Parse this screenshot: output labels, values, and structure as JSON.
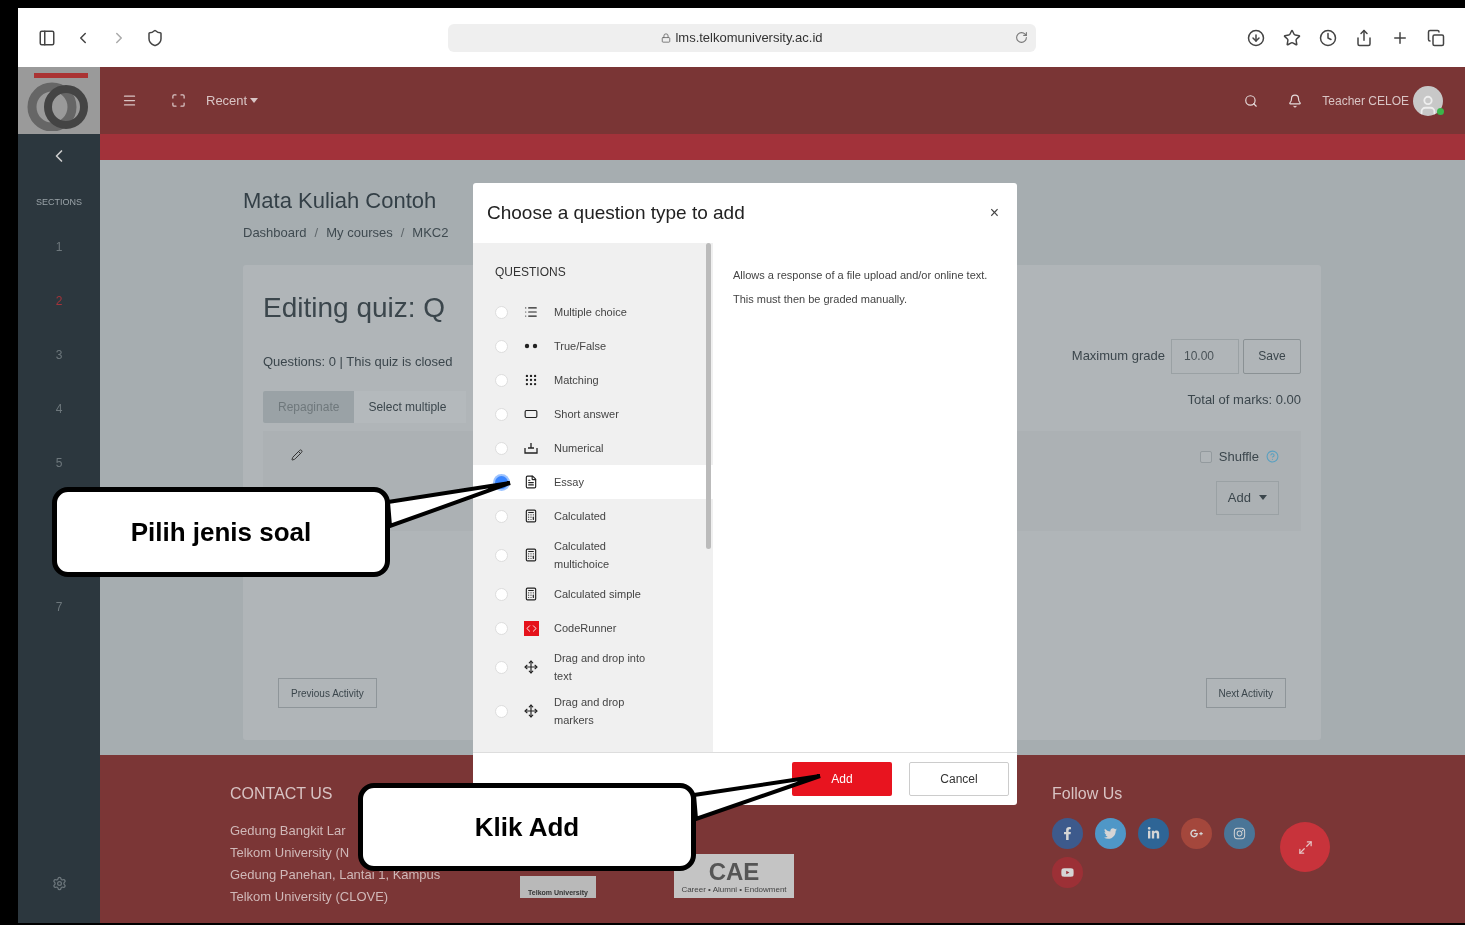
{
  "browser": {
    "url": "lms.telkomuniversity.ac.id"
  },
  "header": {
    "menu_label": "Recent",
    "user_name": "Teacher CELOE",
    "online": true
  },
  "sidebar": {
    "heading": "SECTIONS",
    "sections": [
      {
        "label": "1",
        "selected": false
      },
      {
        "label": "2",
        "selected": true
      },
      {
        "label": "3",
        "selected": false
      },
      {
        "label": "4",
        "selected": false
      },
      {
        "label": "5",
        "selected": false
      },
      {
        "label": "7",
        "selected": false
      }
    ]
  },
  "page": {
    "title": "Mata Kuliah Contoh",
    "breadcrumb": [
      "Dashboard",
      "My courses",
      "MKC2"
    ],
    "breadcrumb_separator": "/",
    "quiz_title": "Editing quiz: Q",
    "summary": "Questions: 0 | This quiz is closed",
    "repaginate": "Repaginate",
    "select_multiple": "Select multiple",
    "max_grade_label": "Maximum grade",
    "max_grade_value": "10.00",
    "save": "Save",
    "total_marks": "Total of marks: 0.00",
    "shuffle": {
      "label": "Shuffle",
      "checked": false
    },
    "add_menu": "Add",
    "previous": "Previous Activity",
    "next": "Next Activity"
  },
  "modal": {
    "title": "Choose a question type to add",
    "close": "×",
    "section": "QUESTIONS",
    "questions": [
      {
        "label": "Multiple choice",
        "kind": "list",
        "selected": false
      },
      {
        "label": "True/False",
        "kind": "dots",
        "selected": false
      },
      {
        "label": "Matching",
        "kind": "grid",
        "selected": false
      },
      {
        "label": "Short answer",
        "kind": "field",
        "selected": false
      },
      {
        "label": "Numerical",
        "kind": "numeric",
        "selected": false
      },
      {
        "label": "Essay",
        "kind": "page",
        "selected": true
      },
      {
        "label": "Calculated",
        "kind": "calc",
        "selected": false
      },
      {
        "label": "Calculated multichoice",
        "kind": "calc",
        "selected": false
      },
      {
        "label": "Calculated simple",
        "kind": "calc",
        "selected": false
      },
      {
        "label": "CodeRunner",
        "kind": "code",
        "selected": false
      },
      {
        "label": "Drag and drop into text",
        "kind": "move",
        "selected": false
      },
      {
        "label": "Drag and drop markers",
        "kind": "move",
        "selected": false
      }
    ],
    "description": "Allows a response of a file upload and/or online text. This must then be graded manually.",
    "buttons": [
      {
        "label": "Add",
        "kind": "primary"
      },
      {
        "label": "Cancel",
        "kind": "secondary"
      }
    ]
  },
  "footer": {
    "contact_heading": "CONTACT US",
    "contact_lines": [
      "Gedung Bangkit Lar",
      "Telkom University (N",
      "Gedung Panehan, Lantai 1, Kampus",
      "Telkom University (CLOVE)"
    ],
    "library_logo": "Telkom University",
    "cae_logo": "CAE",
    "cae_tagline": "Career • Alumni • Endowment",
    "follow_heading": "Follow Us",
    "social": [
      {
        "kind": "facebook",
        "color": "#3d5a8c"
      },
      {
        "kind": "twitter",
        "color": "#4f97c7"
      },
      {
        "kind": "linkedin",
        "color": "#2e6596"
      },
      {
        "kind": "googleplus",
        "color": "#a4473c"
      },
      {
        "kind": "instagram",
        "color": "#4a7597"
      },
      {
        "kind": "youtube",
        "color": "#9c3036"
      }
    ]
  },
  "callouts": [
    {
      "text": "Pilih jenis soal"
    },
    {
      "text": "Klik Add"
    }
  ]
}
